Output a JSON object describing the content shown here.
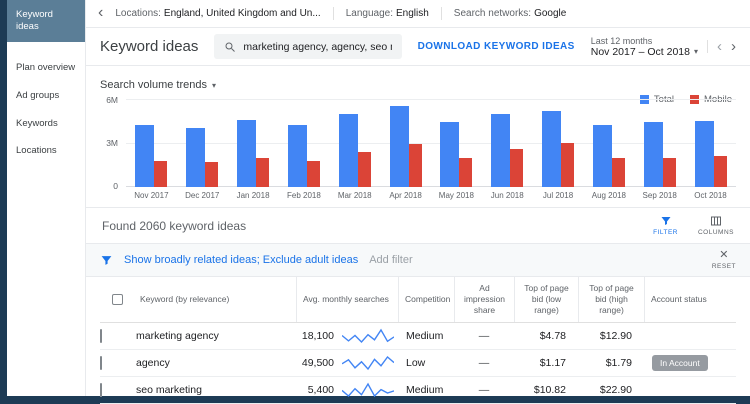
{
  "colors": {
    "total": "#4285f4",
    "mobile": "#db4437",
    "accent": "#1a73e8",
    "selected_nav": "#5b7e97",
    "page_edge": "#1d3b55"
  },
  "sidebar": {
    "items": [
      {
        "label": "Keyword ideas",
        "selected": true
      },
      {
        "label": "Plan overview",
        "selected": false
      },
      {
        "label": "Ad groups",
        "selected": false
      },
      {
        "label": "Keywords",
        "selected": false
      },
      {
        "label": "Locations",
        "selected": false
      }
    ]
  },
  "topbar": {
    "back_icon": "‹",
    "settings": [
      {
        "label": "Locations:",
        "value": "England, United Kingdom and Un..."
      },
      {
        "label": "Language:",
        "value": "English"
      },
      {
        "label": "Search networks:",
        "value": "Google"
      }
    ]
  },
  "header": {
    "title": "Keyword ideas",
    "search_value": "marketing agency, agency, seo marketing",
    "download_label": "DOWNLOAD KEYWORD IDEAS",
    "range_label": "Last 12 months",
    "range_value": "Nov 2017 – Oct 2018",
    "caret_icon": "▾",
    "prev_icon": "‹",
    "next_icon": "›"
  },
  "chart_section": {
    "dropdown_label": "Search volume trends",
    "caret_icon": "▾",
    "legend": [
      {
        "label": "Total",
        "color": "#4285f4"
      },
      {
        "label": "Mobile",
        "color": "#db4437"
      }
    ]
  },
  "chart_data": {
    "type": "bar",
    "title": "Search volume trends",
    "categories": [
      "Nov 2017",
      "Dec 2017",
      "Jan 2018",
      "Feb 2018",
      "Mar 2018",
      "Apr 2018",
      "May 2018",
      "Jun 2018",
      "Jul 2018",
      "Aug 2018",
      "Sep 2018",
      "Oct 2018"
    ],
    "series": [
      {
        "name": "Total",
        "color": "#4285f4",
        "values": [
          4.2,
          4.0,
          4.6,
          4.2,
          5.0,
          5.5,
          4.4,
          5.0,
          5.2,
          4.2,
          4.4,
          4.5
        ]
      },
      {
        "name": "Mobile",
        "color": "#db4437",
        "values": [
          1.8,
          1.7,
          2.0,
          1.8,
          2.4,
          2.9,
          2.0,
          2.6,
          3.0,
          2.0,
          2.0,
          2.1
        ]
      }
    ],
    "xlabel": "",
    "ylabel": "",
    "ylim": [
      0,
      6
    ],
    "yticks": [
      "6M",
      "3M",
      "0"
    ],
    "unit": "millions",
    "grid": true,
    "legend_position": "top-right"
  },
  "results": {
    "found_text": "Found 2060 keyword ideas",
    "filter_label": "FILTER",
    "columns_label": "COLUMNS"
  },
  "filter_bar": {
    "applied_filters": "Show broadly related ideas; Exclude adult ideas",
    "add_filter": "Add filter",
    "close_icon": "✕",
    "reset_label": "RESET"
  },
  "table": {
    "headers": {
      "keyword": "Keyword (by relevance)",
      "searches": "Avg. monthly searches",
      "competition": "Competition",
      "impression": "Ad impression share",
      "bid_low": "Top of page bid (low range)",
      "bid_high": "Top of page bid (high range)",
      "account": "Account status"
    },
    "rows": [
      {
        "keyword": "marketing agency",
        "searches": "18,100",
        "sparkline": [
          3.0,
          1.5,
          3.0,
          1.2,
          3.2,
          1.8,
          4.5,
          1.4,
          2.6
        ],
        "competition": "Medium",
        "impression": "—",
        "bid_low": "$4.78",
        "bid_high": "$12.90",
        "account": ""
      },
      {
        "keyword": "agency",
        "searches": "49,500",
        "sparkline": [
          2.5,
          3.5,
          1.5,
          3.0,
          1.2,
          3.6,
          2.0,
          4.2,
          2.8
        ],
        "competition": "Low",
        "impression": "—",
        "bid_low": "$1.17",
        "bid_high": "$1.79",
        "account": "In Account"
      },
      {
        "keyword": "seo marketing",
        "searches": "5,400",
        "sparkline": [
          2.8,
          1.5,
          3.2,
          1.8,
          4.3,
          1.5,
          3.0,
          2.2,
          2.7
        ],
        "competition": "Medium",
        "impression": "—",
        "bid_low": "$10.82",
        "bid_high": "$22.90",
        "account": ""
      }
    ]
  }
}
